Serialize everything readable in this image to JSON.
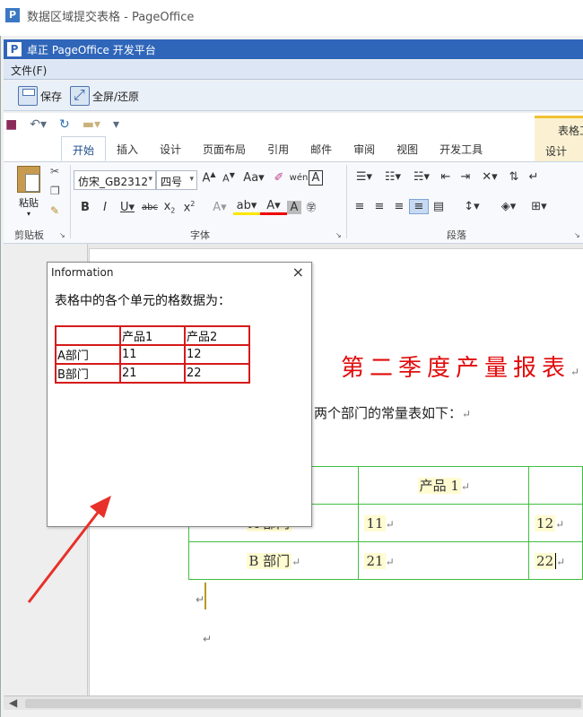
{
  "window": {
    "title": "数据区域提交表格 - PageOffice",
    "app_icon": "P"
  },
  "pageoffice_bar": {
    "icon": "P",
    "title": "卓正 PageOffice 开发平台"
  },
  "menu": {
    "file": "文件(F)"
  },
  "toolbar": {
    "save": "保存",
    "fullscreen": "全屏/还原"
  },
  "ribbon": {
    "tabs": [
      "开始",
      "插入",
      "设计",
      "页面布局",
      "引用",
      "邮件",
      "审阅",
      "视图",
      "开发工具"
    ],
    "active_tab": "开始",
    "context_tab_group": "表格工",
    "context_tab": "设计",
    "paste_label": "粘贴",
    "font_name": "仿宋_GB2312",
    "font_size": "四号",
    "groups": {
      "clipboard": "剪贴板",
      "font": "字体",
      "paragraph": "段落"
    }
  },
  "document": {
    "heading": "第二季度产量报表",
    "subtext": "两个部门的常量表如下：",
    "table": {
      "header": [
        "",
        "产品 1",
        ""
      ],
      "rows": [
        [
          "A 部门",
          "11",
          "12"
        ],
        [
          "B 部门",
          "21",
          "22"
        ]
      ]
    }
  },
  "dialog": {
    "title": "Information",
    "close": "×",
    "message": "表格中的各个单元的格数据为：",
    "table": {
      "header": [
        "",
        "产品1",
        "产品2"
      ],
      "rows": [
        [
          "A部门",
          "11",
          "12"
        ],
        [
          "B部门",
          "21",
          "22"
        ]
      ]
    }
  },
  "colors": {
    "heading": "#e10b0b",
    "table_border": "#3fbf3f",
    "dialog_table_border": "#d61a1a",
    "arrow": "#e8302a",
    "title_bar": "#2f66b9"
  }
}
